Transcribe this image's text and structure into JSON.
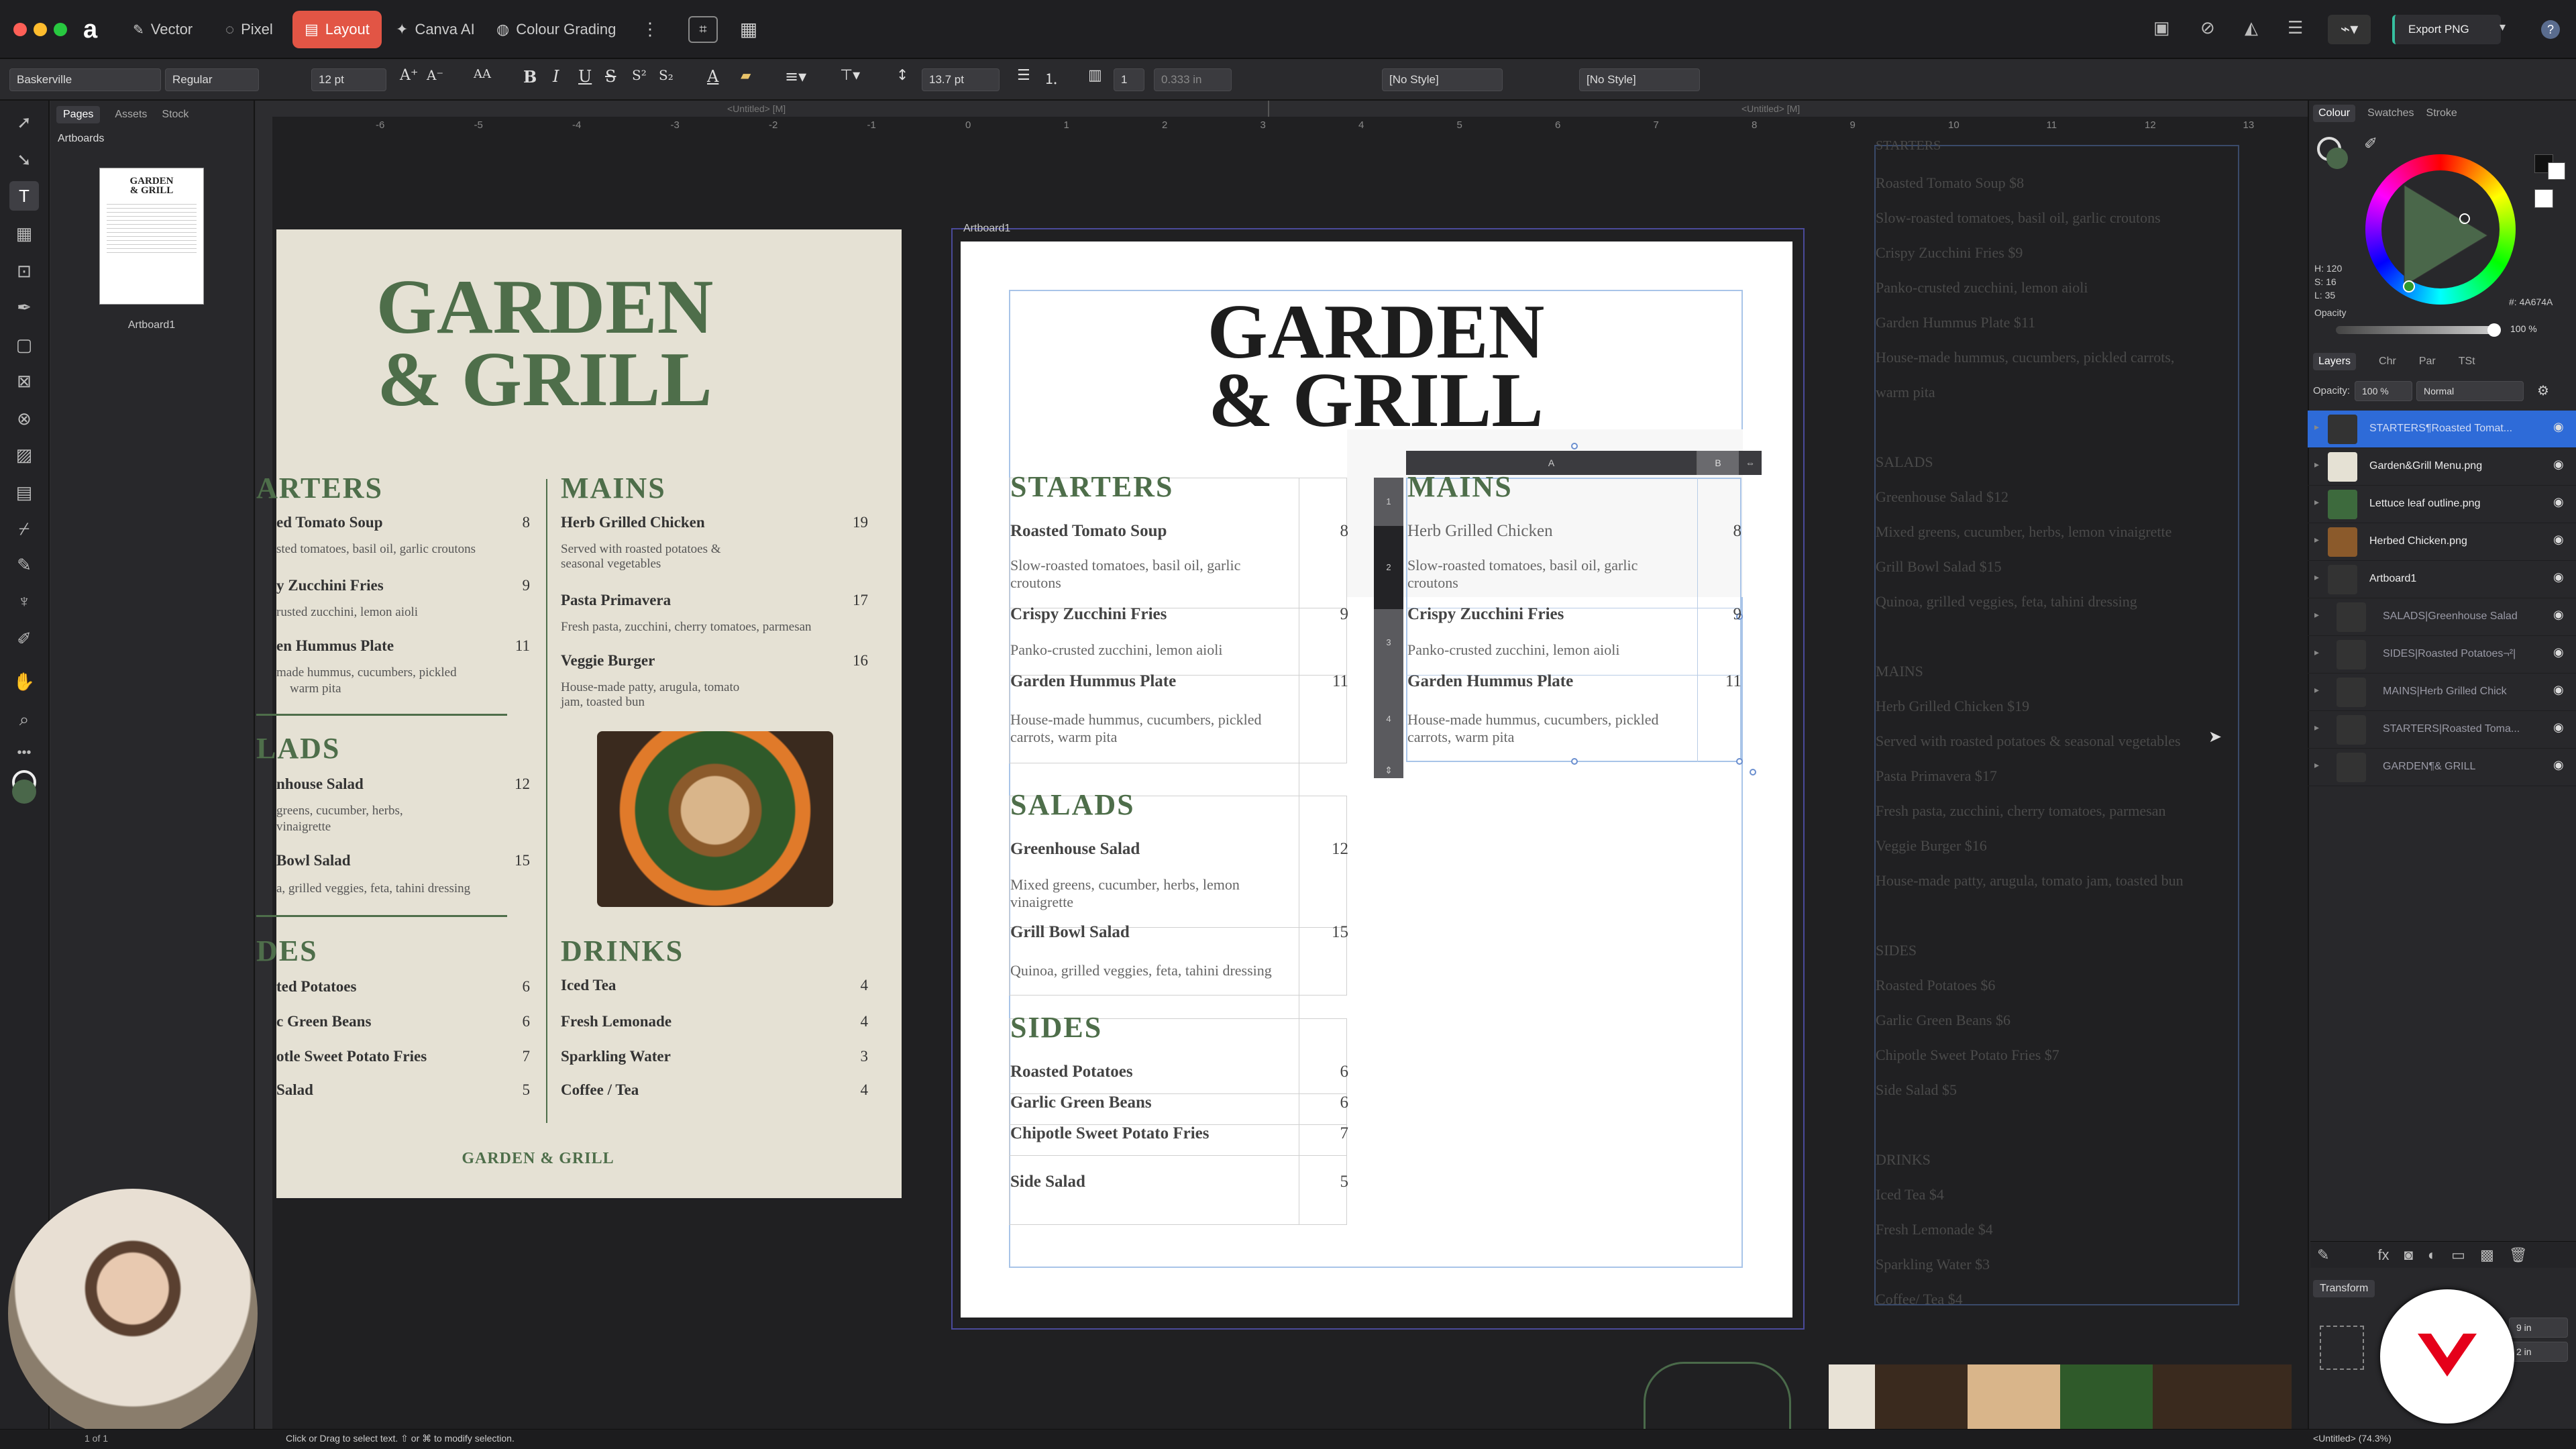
{
  "app": {
    "personas": [
      "Vector",
      "Pixel",
      "Layout",
      "Canva AI",
      "Colour Grading"
    ],
    "export_label": "Export PNG"
  },
  "context": {
    "font": "Baskerville",
    "style": "Regular",
    "size": "12 pt",
    "leading": "13.7 pt",
    "indent_count": "1",
    "indent_value": "0.333 in",
    "para_style": "[No Style]",
    "char_style": "[No Style]"
  },
  "pages_panel": {
    "tabs": [
      "Pages",
      "Assets",
      "Stock"
    ],
    "section": "Artboards",
    "thumb_label": "Artboard1"
  },
  "rulers": {
    "left_title": "<Untitled> [M]",
    "right_title": "<Untitled> [M]",
    "h_ticks": [
      "-6",
      "-5",
      "-4",
      "-3",
      "-2",
      "-1",
      "0",
      "1",
      "2",
      "3",
      "4",
      "5",
      "6",
      "7",
      "8",
      "9",
      "10",
      "11",
      "12",
      "13"
    ]
  },
  "artboard_label": "Artboard1",
  "menu": {
    "title1": "GARDEN",
    "title2": "& GRILL",
    "footer": "GARDEN & GRILL",
    "starters": {
      "heading": "STARTERS",
      "heading_cut": "ARTERS",
      "items": [
        {
          "name": "Roasted Tomato Soup",
          "cut": "ed Tomato Soup",
          "price": "8",
          "desc": "Slow-roasted tomatoes, basil oil, garlic croutons",
          "desc_cut": "sted tomatoes, basil oil, garlic croutons"
        },
        {
          "name": "Crispy Zucchini Fries",
          "cut": "y Zucchini Fries",
          "price": "9",
          "desc": "Panko-crusted zucchini, lemon aioli",
          "desc_cut": "rusted zucchini, lemon aioli"
        },
        {
          "name": "Garden Hummus Plate",
          "cut": "en Hummus Plate",
          "price": "11",
          "desc": "House-made hummus, cucumbers, pickled carrots, warm pita",
          "desc_cut": "made hummus, cucumbers, pickled",
          "desc_cut2": "warm pita"
        }
      ]
    },
    "salads": {
      "heading": "SALADS",
      "heading_cut": "LADS",
      "items": [
        {
          "name": "Greenhouse Salad",
          "cut": "nhouse Salad",
          "price": "12",
          "desc": "Mixed greens, cucumber, herbs, lemon vinaigrette",
          "desc_cut": "greens, cucumber, herbs,",
          "desc_cut2": "vinaigrette"
        },
        {
          "name": "Grill Bowl Salad",
          "cut": "Bowl Salad",
          "price": "15",
          "desc": "Quinoa, grilled veggies, feta, tahini dressing",
          "desc_cut": "a, grilled veggies, feta, tahini dressing"
        }
      ]
    },
    "sides": {
      "heading": "SIDES",
      "heading_cut": "DES",
      "items": [
        {
          "name": "Roasted Potatoes",
          "cut": "ted Potatoes",
          "price": "6"
        },
        {
          "name": "Garlic Green Beans",
          "cut": "c Green Beans",
          "price": "6"
        },
        {
          "name": "Chipotle Sweet Potato Fries",
          "cut": "otle Sweet Potato Fries",
          "price": "7"
        },
        {
          "name": "Side Salad",
          "cut": "Salad",
          "price": "5"
        }
      ]
    },
    "mains": {
      "heading": "MAINS",
      "items": [
        {
          "name": "Herb Grilled Chicken",
          "price": "19",
          "desc": "Served with roasted potatoes & seasonal vegetables"
        },
        {
          "name": "Pasta Primavera",
          "price": "17",
          "desc": "Fresh pasta, zucchini, cherry tomatoes, parmesan"
        },
        {
          "name": "Veggie Burger",
          "price": "16",
          "desc": "House-made patty, arugula, tomato jam, toasted bun"
        }
      ]
    },
    "drinks": {
      "heading": "DRINKS",
      "items": [
        {
          "name": "Iced Tea",
          "price": "4"
        },
        {
          "name": "Fresh Lemonade",
          "price": "4"
        },
        {
          "name": "Sparkling Water",
          "price": "3"
        },
        {
          "name": "Coffee / Tea",
          "price": "4"
        }
      ]
    }
  },
  "table_header": {
    "col_a": "A",
    "col_b": "B",
    "rows": [
      "1",
      "2",
      "3",
      "4"
    ]
  },
  "ghost_text": {
    "lines": [
      "Roasted Tomato Soup  $8",
      "Slow-roasted tomatoes, basil oil, garlic croutons",
      "Crispy Zucchini Fries  $9",
      "Panko-crusted zucchini, lemon aioli",
      "Garden Hummus Plate  $11",
      "House-made hummus, cucumbers, pickled carrots,",
      "warm pita",
      "",
      "SALADS",
      "Greenhouse Salad  $12",
      "Mixed greens, cucumber, herbs, lemon vinaigrette",
      "Grill Bowl Salad  $15",
      "Quinoa, grilled veggies, feta, tahini dressing",
      "",
      "MAINS",
      "Herb Grilled Chicken  $19",
      "Served with roasted potatoes & seasonal vegetables",
      "Pasta Primavera  $17",
      "Fresh pasta, zucchini, cherry tomatoes, parmesan",
      "Veggie Burger  $16",
      "House-made patty, arugula, tomato jam, toasted bun",
      "",
      "SIDES",
      "Roasted Potatoes  $6",
      "Garlic Green Beans  $6",
      "Chipotle Sweet Potato Fries  $7",
      "Side Salad  $5",
      "",
      "DRINKS",
      "Iced Tea  $4",
      "Fresh Lemonade $4",
      "Sparkling Water  $3",
      "Coffee/ Tea $4"
    ],
    "top": "STARTERS"
  },
  "colour_panel": {
    "tabs": [
      "Colour",
      "Swatches",
      "Stroke"
    ],
    "h": "H: 120",
    "s": "S: 16",
    "l": "L: 35",
    "hex": "#: 4A674A",
    "opacity_label": "Opacity",
    "opacity_value": "100 %"
  },
  "layers_panel": {
    "tabs": [
      "Layers",
      "Chr",
      "Par",
      "TSt"
    ],
    "opacity_label": "Opacity:",
    "opacity_value": "100 %",
    "blend": "Normal",
    "layers": [
      {
        "name": "STARTERS¶Roasted Tomat..."
      },
      {
        "name": "Garden&Grill Menu.png"
      },
      {
        "name": "Lettuce leaf outline.png"
      },
      {
        "name": "Herbed Chicken.png"
      },
      {
        "name": "Artboard1"
      },
      {
        "name": "SALADS|Greenhouse Salad"
      },
      {
        "name": "SIDES|Roasted Potatoes¬²|"
      },
      {
        "name": "MAINS|Herb Grilled Chick"
      },
      {
        "name": "STARTERS|Roasted Toma..."
      },
      {
        "name": "GARDEN¶& GRILL"
      }
    ]
  },
  "transform_panel": {
    "title": "Transform",
    "w": "9 in",
    "h": "2 in"
  },
  "status": {
    "page": "1 of 1",
    "hint": "Click or Drag to select text. ⇧ or ⌘ to modify selection.",
    "doc": "<Untitled> (74.3%)"
  }
}
